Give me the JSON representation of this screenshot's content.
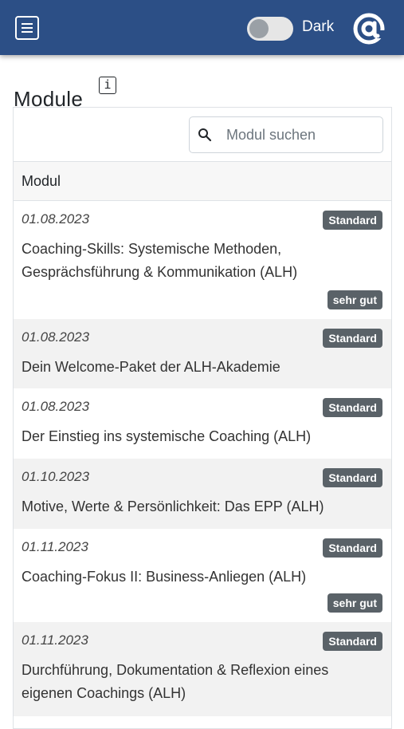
{
  "header": {
    "dark_label": "Dark",
    "accent_color": "#2c4f86",
    "logo_icon": "at-sign-logo",
    "menu_icon": "hamburger-menu-icon",
    "dark_mode_enabled": false
  },
  "page": {
    "title": "Module",
    "info_glyph": "i"
  },
  "search": {
    "placeholder": "Modul suchen",
    "value": ""
  },
  "table": {
    "column_header": "Modul",
    "rows": [
      {
        "date": "01.08.2023",
        "badge": "Standard",
        "title": "Coaching-Skills: Systemische Methoden, Gesprächsführung & Kommunikation (ALH)",
        "grade": "sehr gut"
      },
      {
        "date": "01.08.2023",
        "badge": "Standard",
        "title": "Dein Welcome-Paket der ALH-Akademie",
        "grade": ""
      },
      {
        "date": "01.08.2023",
        "badge": "Standard",
        "title": "Der Einstieg ins systemische Coaching (ALH)",
        "grade": ""
      },
      {
        "date": "01.10.2023",
        "badge": "Standard",
        "title": "Motive, Werte & Persönlichkeit: Das EPP (ALH)",
        "grade": ""
      },
      {
        "date": "01.11.2023",
        "badge": "Standard",
        "title": "Coaching-Fokus II: Business-Anliegen (ALH)",
        "grade": "sehr gut"
      },
      {
        "date": "01.11.2023",
        "badge": "Standard",
        "title": "Durchführung, Dokumentation & Reflexion eines eigenen Coachings (ALH)",
        "grade": ""
      }
    ]
  }
}
